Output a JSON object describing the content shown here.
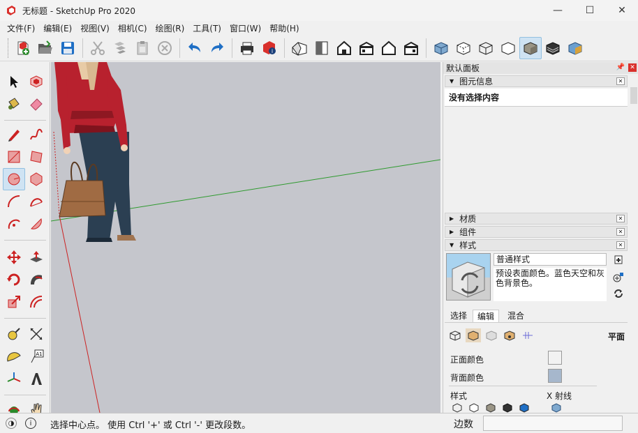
{
  "window": {
    "title": "无标题 - SketchUp Pro 2020",
    "minimize": "—",
    "maximize": "☐",
    "close": "✕"
  },
  "menu": [
    "文件(F)",
    "编辑(E)",
    "视图(V)",
    "相机(C)",
    "绘图(R)",
    "工具(T)",
    "窗口(W)",
    "帮助(H)"
  ],
  "tray": {
    "title": "默认面板",
    "pin": "📌",
    "close": "✕",
    "panels": {
      "entity_info": "图元信息",
      "entity_info_empty": "没有选择内容",
      "materials": "材质",
      "components": "组件",
      "styles": "样式"
    },
    "style": {
      "name": "普通样式",
      "description": "预设表面颜色。蓝色天空和灰色背景色。",
      "tabs": [
        "选择",
        "编辑",
        "混合"
      ],
      "mode_label": "平面",
      "front_color_label": "正面颜色",
      "back_color_label": "背面颜色",
      "style_label": "样式",
      "xray_label": "X 射线",
      "front_color": "#f2f2f2",
      "back_color": "#a6b7cc"
    }
  },
  "statusbar": {
    "hint": "选择中心点。 使用 Ctrl '+' 或 Ctrl '-' 更改段数。",
    "measurements_label": "边数",
    "measurements_value": ""
  },
  "colors": {
    "viewport_bg": "#c5c6cc",
    "accent_blue": "#1f6fc5",
    "brand_red": "#d9302c"
  }
}
